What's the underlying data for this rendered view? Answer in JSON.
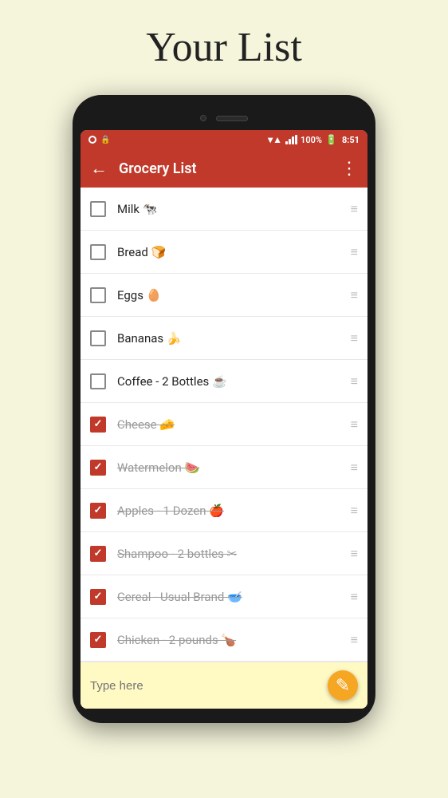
{
  "page": {
    "title": "Your List",
    "background": "#f5f5dc"
  },
  "statusBar": {
    "battery": "100%",
    "time": "8:51"
  },
  "toolbar": {
    "title": "Grocery List",
    "back_label": "←",
    "menu_label": "⋮"
  },
  "items": [
    {
      "id": 1,
      "text": "Milk 🐄",
      "checked": false
    },
    {
      "id": 2,
      "text": "Bread 🍞",
      "checked": false
    },
    {
      "id": 3,
      "text": "Eggs 🥚",
      "checked": false
    },
    {
      "id": 4,
      "text": "Bananas 🍌",
      "checked": false
    },
    {
      "id": 5,
      "text": "Coffee - 2 Bottles ☕",
      "checked": false
    },
    {
      "id": 6,
      "text": "Cheese 🧀",
      "checked": true
    },
    {
      "id": 7,
      "text": "Watermelon 🍉",
      "checked": true
    },
    {
      "id": 8,
      "text": "Apples - 1 Dozen 🍎",
      "checked": true
    },
    {
      "id": 9,
      "text": "Shampoo - 2 bottles ✂",
      "checked": true
    },
    {
      "id": 10,
      "text": "Cereal - Usual Brand 🥣",
      "checked": true
    },
    {
      "id": 11,
      "text": "Chicken - 2 pounds 🍗",
      "checked": true
    }
  ],
  "bottomBar": {
    "placeholder": "Type here",
    "fab_icon": "✎"
  }
}
